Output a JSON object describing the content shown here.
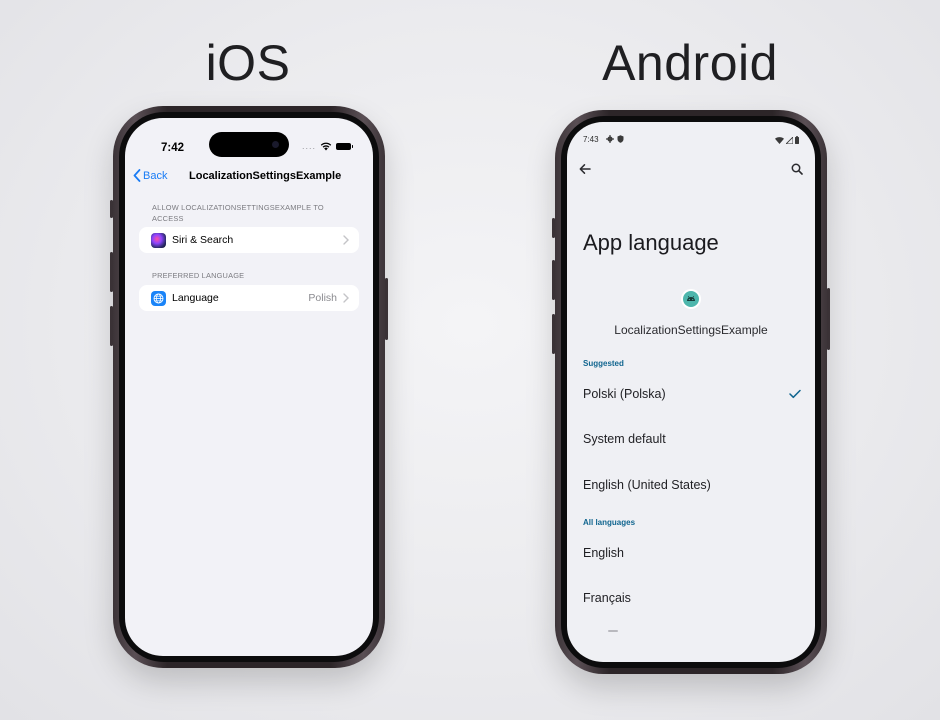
{
  "headings": {
    "ios": "iOS",
    "android": "Android"
  },
  "colors": {
    "ios_accent": "#1a7cf5",
    "android_accent": "#10658f",
    "android_app_icon": "#4db6ac"
  },
  "ios": {
    "status": {
      "time": "7:42",
      "dots": "...."
    },
    "nav": {
      "back_label": "Back",
      "title": "LocalizationSettingsExample"
    },
    "sections": [
      {
        "header": "ALLOW LOCALIZATIONSETTINGSEXAMPLE TO ACCESS",
        "rows": [
          {
            "label": "Siri & Search",
            "value": "",
            "icon": "siri-icon"
          }
        ]
      },
      {
        "header": "PREFERRED LANGUAGE",
        "rows": [
          {
            "label": "Language",
            "value": "Polish",
            "icon": "globe-icon"
          }
        ]
      }
    ]
  },
  "android": {
    "status": {
      "time": "7:43"
    },
    "page_title": "App language",
    "app_name": "LocalizationSettingsExample",
    "suggested": {
      "header": "Suggested",
      "items": [
        {
          "label": "Polski (Polska)",
          "selected": true
        },
        {
          "label": "System default",
          "selected": false
        },
        {
          "label": "English (United States)",
          "selected": false
        }
      ]
    },
    "all_languages": {
      "header": "All languages",
      "items": [
        {
          "label": "English"
        },
        {
          "label": "Français"
        }
      ]
    }
  }
}
